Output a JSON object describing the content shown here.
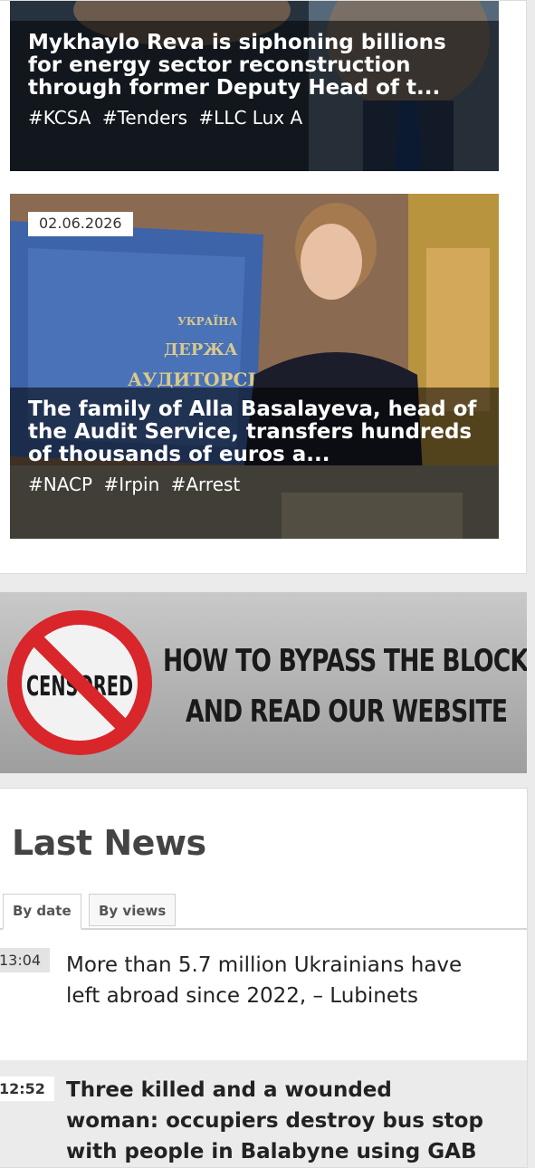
{
  "articles": [
    {
      "title": "Mykhaylo Reva is siphoning billions for energy sector reconstruction through former Deputy Head of t...",
      "tags": [
        "#KCSA",
        "#Tenders",
        "#LLC Lux A"
      ]
    },
    {
      "date": "02.06.2026",
      "title": "The family of Alla Basalayeva, head of the Audit Service, transfers hundreds of thousands of euros a...",
      "tags": [
        "#NACP",
        "#Irpin",
        "#Arrest"
      ],
      "sign_text_1": "УКРАЇНА",
      "sign_text_2": "ДЕРЖА",
      "sign_text_3": "АУДИТОРСЬ"
    }
  ],
  "banner": {
    "stamp_text": "CENSORED",
    "line1": "HOW TO BYPASS THE BLOCK",
    "line2": "AND READ OUR WEBSITE"
  },
  "last_news": {
    "heading": "Last News",
    "tabs": [
      "By date",
      "By views"
    ],
    "items": [
      {
        "time": "13:04",
        "text": "More than 5.7 million Ukrainians have left abroad since 2022, – Lubinets",
        "bold": false
      },
      {
        "time": "12:52",
        "text": "Three killed and a wounded woman: occupiers destroy bus stop with people in Balabyne using GAB",
        "bold": true,
        "icon": "camera-icon"
      }
    ]
  }
}
